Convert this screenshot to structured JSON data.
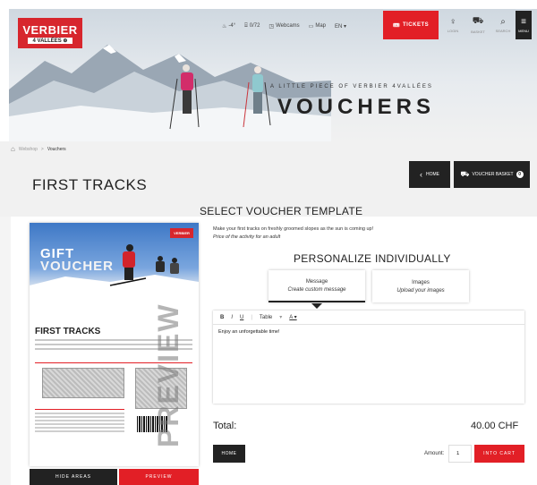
{
  "brand": {
    "logo_line1": "VERBIER",
    "logo_line2": "4 VALLÉES ⊕"
  },
  "topnav": [
    {
      "icon": "thermometer-icon",
      "glyph": "♨",
      "label": "-4°"
    },
    {
      "icon": "lift-icon",
      "glyph": "⌸",
      "label": "0/72"
    },
    {
      "icon": "webcam-icon",
      "glyph": "◳",
      "label": "Webcams"
    },
    {
      "icon": "map-icon",
      "glyph": "▭",
      "label": "Map"
    },
    {
      "icon": "language-icon",
      "glyph": "",
      "label": "EN ▾"
    }
  ],
  "tickets_label": "TICKETS",
  "right_icons": [
    {
      "icon": "user-icon",
      "glyph": "♀",
      "label": "LOGIN"
    },
    {
      "icon": "cart-icon",
      "glyph": "⛟",
      "label": "BASKET"
    },
    {
      "icon": "search-icon",
      "glyph": "⌕",
      "label": "SEARCH"
    }
  ],
  "menu": {
    "glyph": "≡",
    "label": "MENU"
  },
  "hero": {
    "subtitle": "A LITTLE PIECE OF VERBIER 4VALLÉES",
    "title": "VOUCHERS"
  },
  "breadcrumb": {
    "home_glyph": "⌂",
    "item1": "Webshop",
    "sep": ">",
    "current": "Vouchers"
  },
  "page_title": "FIRST TRACKS",
  "buttons": {
    "home_top": "HOME",
    "voucher_basket": "VOUCHER BASKET",
    "basket_count": "0",
    "hide_areas": "HIDE AREAS",
    "preview": "PREVIEW",
    "home_bottom": "HOME",
    "into_cart": "INTO CART"
  },
  "select_title": "SELECT VOUCHER TEMPLATE",
  "voucher": {
    "gift": "GIFT",
    "voucher": "VOUCHER",
    "logo": "VERBIER",
    "name": "FIRST TRACKS",
    "watermark": "PREVIEW"
  },
  "description": {
    "line1": "Make your first tracks on freshly groomed slopes as the sun is coming up!",
    "line2": "Price of the activity for an adult"
  },
  "personalize": {
    "title": "PERSONALIZE INDIVIDUALLY",
    "tabs": [
      {
        "title": "Message",
        "sub": "Create custom message"
      },
      {
        "title": "Images",
        "sub": "Upload your images"
      }
    ]
  },
  "editor": {
    "bold": "B",
    "italic": "I",
    "underline": "U",
    "style_select": "Table",
    "color": "A ▾",
    "text": "Enjoy an unforgettable time!"
  },
  "total": {
    "label": "Total:",
    "value": "40.00 CHF"
  },
  "amount": {
    "label": "Amount:",
    "value": "1"
  },
  "colors": {
    "accent": "#e21f26",
    "dark": "#222222"
  }
}
